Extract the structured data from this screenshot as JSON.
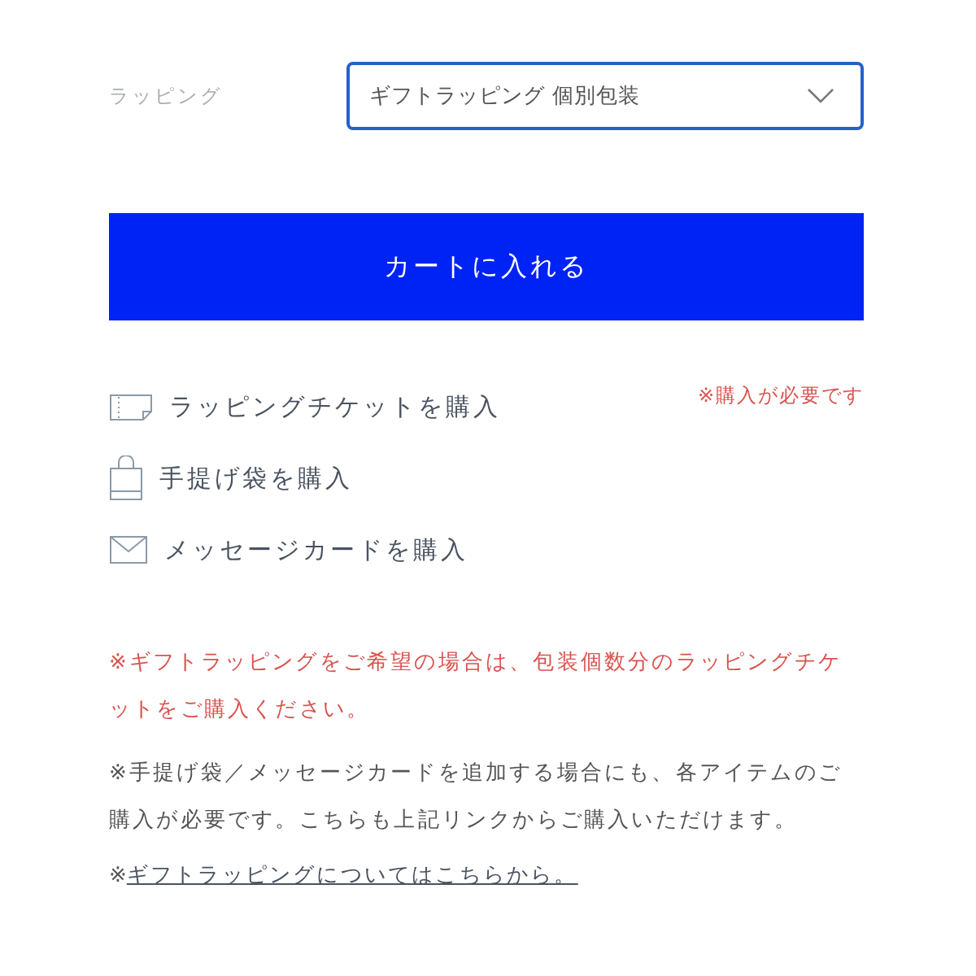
{
  "wrapping": {
    "label": "ラッピング",
    "value": "ギフトラッピング 個別包装"
  },
  "cart_button": "カートに入れる",
  "purchase_links": [
    {
      "kind": "ticket",
      "label": "ラッピングチケットを購入",
      "note": "※購入が必要です"
    },
    {
      "kind": "bag",
      "label": "手提げ袋を購入"
    },
    {
      "kind": "card",
      "label": "メッセージカードを購入"
    }
  ],
  "notes": [
    {
      "kind": "alert",
      "text": "※ギフトラッピングをご希望の場合は、包装個数分のラッピングチケットをご購入ください。"
    },
    {
      "kind": "plain",
      "text": "※手提げ袋／メッセージカードを追加する場合にも、各アイテムのご購入が必要です。こちらも上記リンクからご購入いただけます。"
    },
    {
      "kind": "link",
      "prefix": "※",
      "link": "ギフトラッピングについてはこちらから。"
    }
  ]
}
